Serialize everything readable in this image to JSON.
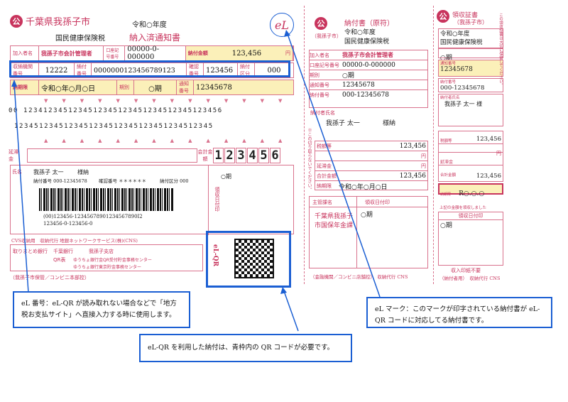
{
  "left_slip": {
    "kou_mark": "公",
    "city": "千葉県我孫子市",
    "era_year": "令和○年度",
    "tax_type": "国民健康保険税",
    "doc_title": "納入済通知書",
    "el_mark": "eL",
    "payer_label": "加入者名",
    "payer_value": "我孫子市会計管理者",
    "acct_label": "口座記号番号",
    "acct_value": "00000-0-000000",
    "amount_label": "納付金額",
    "amount_value": "123,456",
    "yen": "円",
    "inst_label": "収納機関番号",
    "inst_value": "12222",
    "payno_label": "納付番号",
    "payno_value": "0000000123456789123",
    "confirm_label": "確認番号",
    "confirm_value": "123456",
    "cat_label": "納付区分",
    "cat_value": "000",
    "deadline_label": "納期限",
    "deadline_value": "令和○年○月○日",
    "period_label": "期別",
    "period_value": "○期",
    "notice_label": "通知番号",
    "notice_value": "12345678",
    "digit_row1": "00 1234123451234512345123451234512345123456",
    "digit_row2": "1234512345123451234512345123451234512345",
    "delay_label": "延滞金",
    "total_label": "会計金額",
    "big_digits": [
      "1",
      "2",
      "3",
      "4",
      "5",
      "6"
    ],
    "name_label": "氏名",
    "name_value": "我孫子 太一",
    "sama": "様納",
    "payno_small": "納付番号 000-12345678",
    "confirm_small": "確認番号 ＊＊＊＊＊＊",
    "cat_small": "納付区分 000",
    "period_small": "○期",
    "barcode_text1": "(00)123456-12345678901234567890I2",
    "barcode_text2": "123456-0-123456-0",
    "receipt_date_label": "領収日付印",
    "cvs_note": "CVS収納用　収納代行 地銀ネットワークサービス(株)(CNS)",
    "bank_label": "取りまとめ銀行",
    "bank_name": "千葉銀行",
    "bank_branch": "我孫子支店",
    "qr_label": "QR表",
    "qr_note1": "ゆうちょ銀行金QR受付貯金事務センター",
    "qr_note2": "ゆうちょ銀行東京貯金事務センター",
    "footer": "（我孫子市保管／コンビニ本部控）",
    "elqr_label": "eL-QR"
  },
  "mid_slip": {
    "kou_mark": "公",
    "title": "納付書（原符）",
    "city_sub": "（我孫子市）",
    "era_year": "令和○年度",
    "tax_type": "国民健康保険税",
    "payer_label": "加入者名",
    "payer_value": "我孫子市会計管理者",
    "acct_label": "口座記号番号",
    "acct_value": "00000-0-000000",
    "period_label": "期別",
    "period_value": "○期",
    "notice_label": "通知番号",
    "notice_value": "12345678",
    "payno_label": "納付番号",
    "payno_value": "000-12345678",
    "taxpayer_label": "納付者氏名",
    "taxpayer_value": "我孫子 太一",
    "sama": "様納",
    "side_note": "※この切り取らないでください。",
    "tax_label": "税額等",
    "tax_value": "123,456",
    "yen": "円",
    "delay_label": "延滞金",
    "total_label": "合計金額",
    "total_value": "123,456",
    "deadline_label": "納期限",
    "deadline_value": "令和○年○月○日",
    "office_label": "主管課名",
    "receipt_label": "領収日付印",
    "office_value": "千葉県我孫子市国保年金課",
    "receipt_period": "○期",
    "footer": "（金融機関／コンビニ店舗控）　収納代行 CNS"
  },
  "right_slip": {
    "kou_mark": "公",
    "title": "領収証書",
    "city_sub": "（我孫子市）",
    "era_year": "令和○年度",
    "tax_type": "国民健康保険税",
    "period_value": "○期",
    "notice_label": "通知番号",
    "notice_value": "12345678",
    "payno_label": "納付番号",
    "payno_value": "000-12345678",
    "taxpayer_label": "納付者氏名",
    "taxpayer_value": "我孫子 太一 様",
    "tax_label": "税額等",
    "tax_value": "123,456",
    "yen": "円",
    "delay_label": "延滞金",
    "total_label": "合計金額",
    "total_value": "123,456",
    "deadline_label": "納期限",
    "deadline_value": "R○.○.○",
    "receipt_note": "上記の金額を領収しました",
    "receipt_label": "領収日付印",
    "receipt_period": "○期",
    "stamp_note": "収入印紙不要",
    "footer": "（納付者用）　収納代行 CNS",
    "side_note": "この領収証書は大切に保管してください。"
  },
  "callouts": {
    "el_number": "eL 番号：eL-QR が読み取れない場合などで「地方税お支払サイト」へ直接入力する時に使用します。",
    "el_qr": "eL-QR を利用した納付は、青枠内の QR コードが必要です。",
    "el_mark": "eL マーク：このマークが印字されている納付書が eL-QR コードに対応してる納付書です。"
  }
}
